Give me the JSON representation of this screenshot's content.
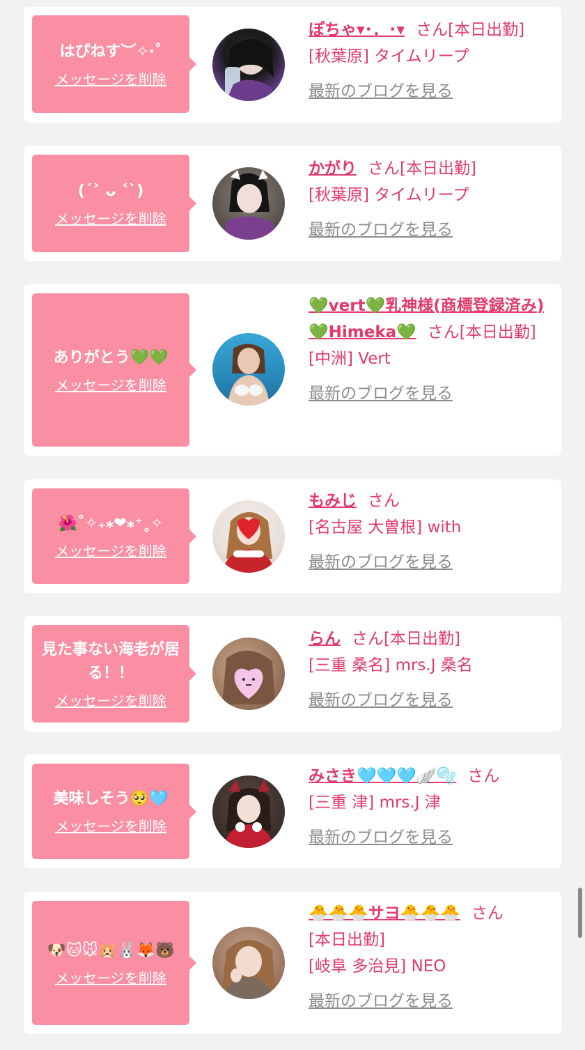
{
  "items": [
    {
      "message": "はぴねす︶✧‧˚",
      "delete_label": "メッセージを削除",
      "name": "ぽちゃ▾･．･▾",
      "san": "さん",
      "status": "[本日出勤]",
      "shop": "[秋葉原] タイムリープ",
      "blog_label": "最新のブログを見る"
    },
    {
      "message": "(ˊ˃ ᴗ ˂ˋ)",
      "delete_label": "メッセージを削除",
      "name": "かがり",
      "san": "さん",
      "status": "[本日出勤]",
      "shop": "[秋葉原] タイムリープ",
      "blog_label": "最新のブログを見る"
    },
    {
      "message": "ありがとう💚💚",
      "delete_label": "メッセージを削除",
      "name": "💚vert💚乳神様(商標登録済み)💚Himeka💚",
      "san": "さん",
      "status": "[本日出勤]",
      "shop": "[中洲] Vert",
      "blog_label": "最新のブログを見る"
    },
    {
      "message": "🌺˚✧₊⁎❤︎⁎⁺˳✧",
      "delete_label": "メッセージを削除",
      "name": "もみじ",
      "san": "さん",
      "status": "",
      "shop": "[名古屋 大曽根] with",
      "blog_label": "最新のブログを見る"
    },
    {
      "message": "見た事ない海老が居る！！",
      "delete_label": "メッセージを削除",
      "name": "らん",
      "san": "さん",
      "status": "[本日出勤]",
      "shop": "[三重 桑名] mrs.J 桑名",
      "blog_label": "最新のブログを見る"
    },
    {
      "message": "美味しそう🥺🩵",
      "delete_label": "メッセージを削除",
      "name": "みさき🩵🩵🩵🪽🫧",
      "san": "さん",
      "status": "",
      "shop": "[三重 津] mrs.J 津",
      "blog_label": "最新のブログを見る"
    },
    {
      "message": "🐶🐱🐭🐹🐰🦊🐻",
      "delete_label": "メッセージを削除",
      "name": "🐣🐣🐣サヨ🐣🐣🐣",
      "san": "さん",
      "status": "[本日出勤]",
      "shop": "[岐阜 多治見] NEO",
      "blog_label": "最新のブログを見る"
    }
  ],
  "colors": {
    "bubble": "#fa8fa3",
    "accent": "#e23a6a",
    "link_gray": "#8c8c8c",
    "background": "#f2f2f2"
  }
}
